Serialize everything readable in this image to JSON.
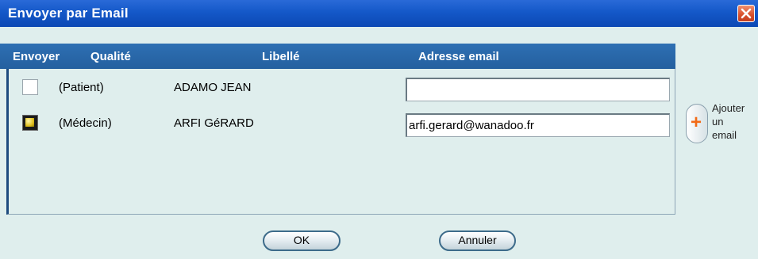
{
  "window": {
    "title": "Envoyer par Email"
  },
  "table": {
    "headers": {
      "envoyer": "Envoyer",
      "qualite": "Qualité",
      "libelle": "Libellé",
      "adresse": "Adresse email"
    },
    "rows": [
      {
        "checked": false,
        "qualite": "(Patient)",
        "libelle": "ADAMO JEAN",
        "email": ""
      },
      {
        "checked": true,
        "qualite": "(Médecin)",
        "libelle": "ARFI GéRARD",
        "email": "arfi.gerard@wanadoo.fr"
      }
    ]
  },
  "add_email": {
    "label_line1": "Ajouter",
    "label_line2": "un",
    "label_line3": "email"
  },
  "buttons": {
    "ok": "OK",
    "cancel": "Annuler"
  }
}
